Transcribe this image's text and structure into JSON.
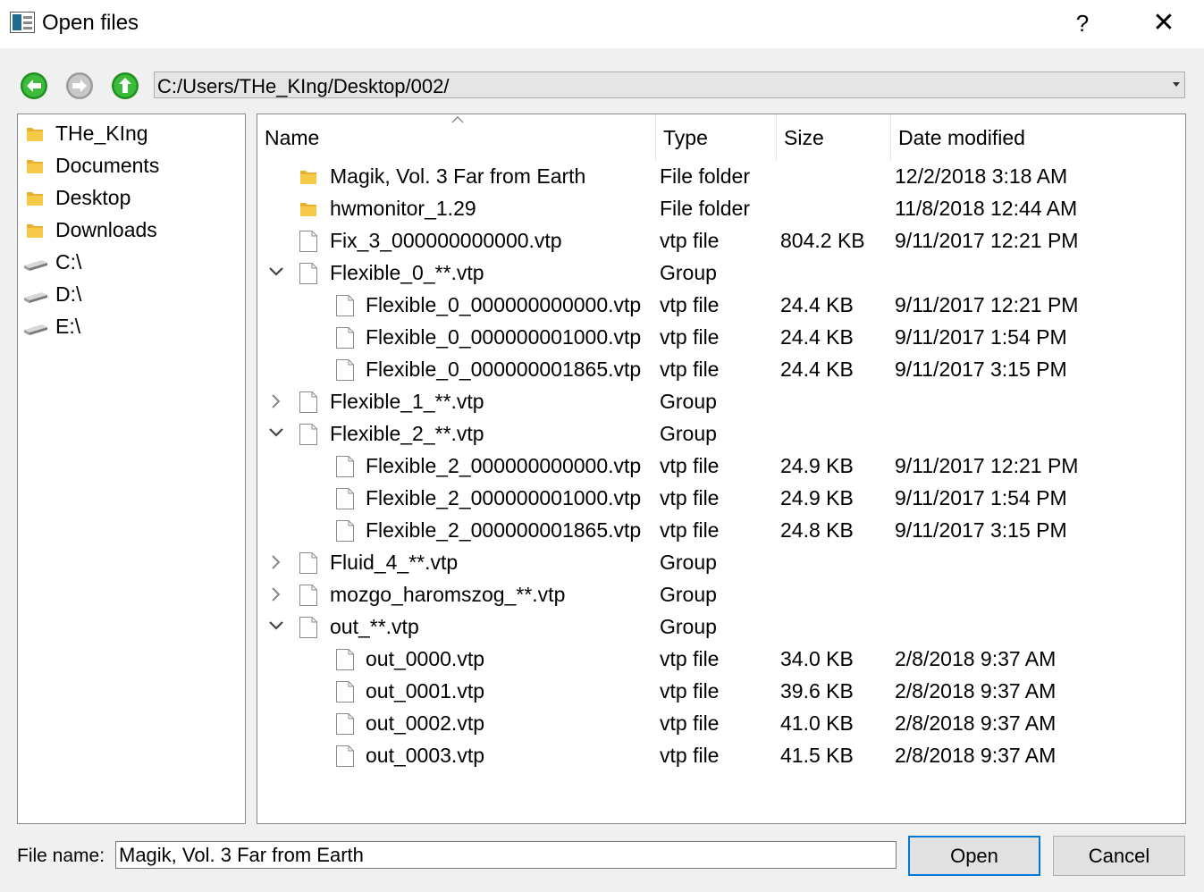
{
  "window": {
    "title": "Open files",
    "help_label": "?",
    "close_label": "✕"
  },
  "toolbar": {
    "back_icon": "back-arrow-icon",
    "forward_icon": "forward-arrow-icon",
    "up_icon": "up-arrow-icon",
    "path": "C:/Users/THe_KIng/Desktop/002/"
  },
  "sidebar": {
    "items": [
      {
        "label": "THe_KIng",
        "icon": "folder-icon"
      },
      {
        "label": "Documents",
        "icon": "folder-icon"
      },
      {
        "label": "Desktop",
        "icon": "folder-icon"
      },
      {
        "label": "Downloads",
        "icon": "folder-icon"
      },
      {
        "label": "C:\\",
        "icon": "drive-icon"
      },
      {
        "label": "D:\\",
        "icon": "drive-icon"
      },
      {
        "label": "E:\\",
        "icon": "drive-icon"
      }
    ]
  },
  "filelist": {
    "columns": {
      "name": "Name",
      "type": "Type",
      "size": "Size",
      "date": "Date modified"
    },
    "rows": [
      {
        "name": "Magik, Vol. 3 Far from Earth",
        "type": "File folder",
        "size": "",
        "date": "12/2/2018 3:18 AM",
        "icon": "folder-icon",
        "level": 0,
        "expand": "none"
      },
      {
        "name": "hwmonitor_1.29",
        "type": "File folder",
        "size": "",
        "date": "11/8/2018 12:44 AM",
        "icon": "folder-icon",
        "level": 0,
        "expand": "none"
      },
      {
        "name": "Fix_3_000000000000.vtp",
        "type": "vtp file",
        "size": "804.2 KB",
        "date": "9/11/2017 12:21 PM",
        "icon": "file-icon",
        "level": 0,
        "expand": "none"
      },
      {
        "name": "Flexible_0_**.vtp",
        "type": "Group",
        "size": "",
        "date": "",
        "icon": "file-icon",
        "level": 0,
        "expand": "expanded"
      },
      {
        "name": "Flexible_0_000000000000.vtp",
        "type": "vtp file",
        "size": "24.4 KB",
        "date": "9/11/2017 12:21 PM",
        "icon": "file-icon",
        "level": 1,
        "expand": "none"
      },
      {
        "name": "Flexible_0_000000001000.vtp",
        "type": "vtp file",
        "size": "24.4 KB",
        "date": "9/11/2017 1:54 PM",
        "icon": "file-icon",
        "level": 1,
        "expand": "none"
      },
      {
        "name": "Flexible_0_000000001865.vtp",
        "type": "vtp file",
        "size": "24.4 KB",
        "date": "9/11/2017 3:15 PM",
        "icon": "file-icon",
        "level": 1,
        "expand": "none"
      },
      {
        "name": "Flexible_1_**.vtp",
        "type": "Group",
        "size": "",
        "date": "",
        "icon": "file-icon",
        "level": 0,
        "expand": "collapsed"
      },
      {
        "name": "Flexible_2_**.vtp",
        "type": "Group",
        "size": "",
        "date": "",
        "icon": "file-icon",
        "level": 0,
        "expand": "expanded"
      },
      {
        "name": "Flexible_2_000000000000.vtp",
        "type": "vtp file",
        "size": "24.9 KB",
        "date": "9/11/2017 12:21 PM",
        "icon": "file-icon",
        "level": 1,
        "expand": "none"
      },
      {
        "name": "Flexible_2_000000001000.vtp",
        "type": "vtp file",
        "size": "24.9 KB",
        "date": "9/11/2017 1:54 PM",
        "icon": "file-icon",
        "level": 1,
        "expand": "none"
      },
      {
        "name": "Flexible_2_000000001865.vtp",
        "type": "vtp file",
        "size": "24.8 KB",
        "date": "9/11/2017 3:15 PM",
        "icon": "file-icon",
        "level": 1,
        "expand": "none"
      },
      {
        "name": "Fluid_4_**.vtp",
        "type": "Group",
        "size": "",
        "date": "",
        "icon": "file-icon",
        "level": 0,
        "expand": "collapsed"
      },
      {
        "name": "mozgo_haromszog_**.vtp",
        "type": "Group",
        "size": "",
        "date": "",
        "icon": "file-icon",
        "level": 0,
        "expand": "collapsed"
      },
      {
        "name": "out_**.vtp",
        "type": "Group",
        "size": "",
        "date": "",
        "icon": "file-icon",
        "level": 0,
        "expand": "expanded"
      },
      {
        "name": "out_0000.vtp",
        "type": "vtp file",
        "size": "34.0 KB",
        "date": "2/8/2018 9:37 AM",
        "icon": "file-icon",
        "level": 1,
        "expand": "none"
      },
      {
        "name": "out_0001.vtp",
        "type": "vtp file",
        "size": "39.6 KB",
        "date": "2/8/2018 9:37 AM",
        "icon": "file-icon",
        "level": 1,
        "expand": "none"
      },
      {
        "name": "out_0002.vtp",
        "type": "vtp file",
        "size": "41.0 KB",
        "date": "2/8/2018 9:37 AM",
        "icon": "file-icon",
        "level": 1,
        "expand": "none"
      },
      {
        "name": "out_0003.vtp",
        "type": "vtp file",
        "size": "41.5 KB",
        "date": "2/8/2018 9:37 AM",
        "icon": "file-icon",
        "level": 1,
        "expand": "none"
      }
    ]
  },
  "footer": {
    "file_name_label": "File name:",
    "file_name_value": "Magik, Vol. 3 Far from Earth",
    "open_label": "Open",
    "cancel_label": "Cancel"
  },
  "colors": {
    "accent": "#0078d7",
    "nav_green": "#2ea52e",
    "folder": "#f5c445"
  }
}
